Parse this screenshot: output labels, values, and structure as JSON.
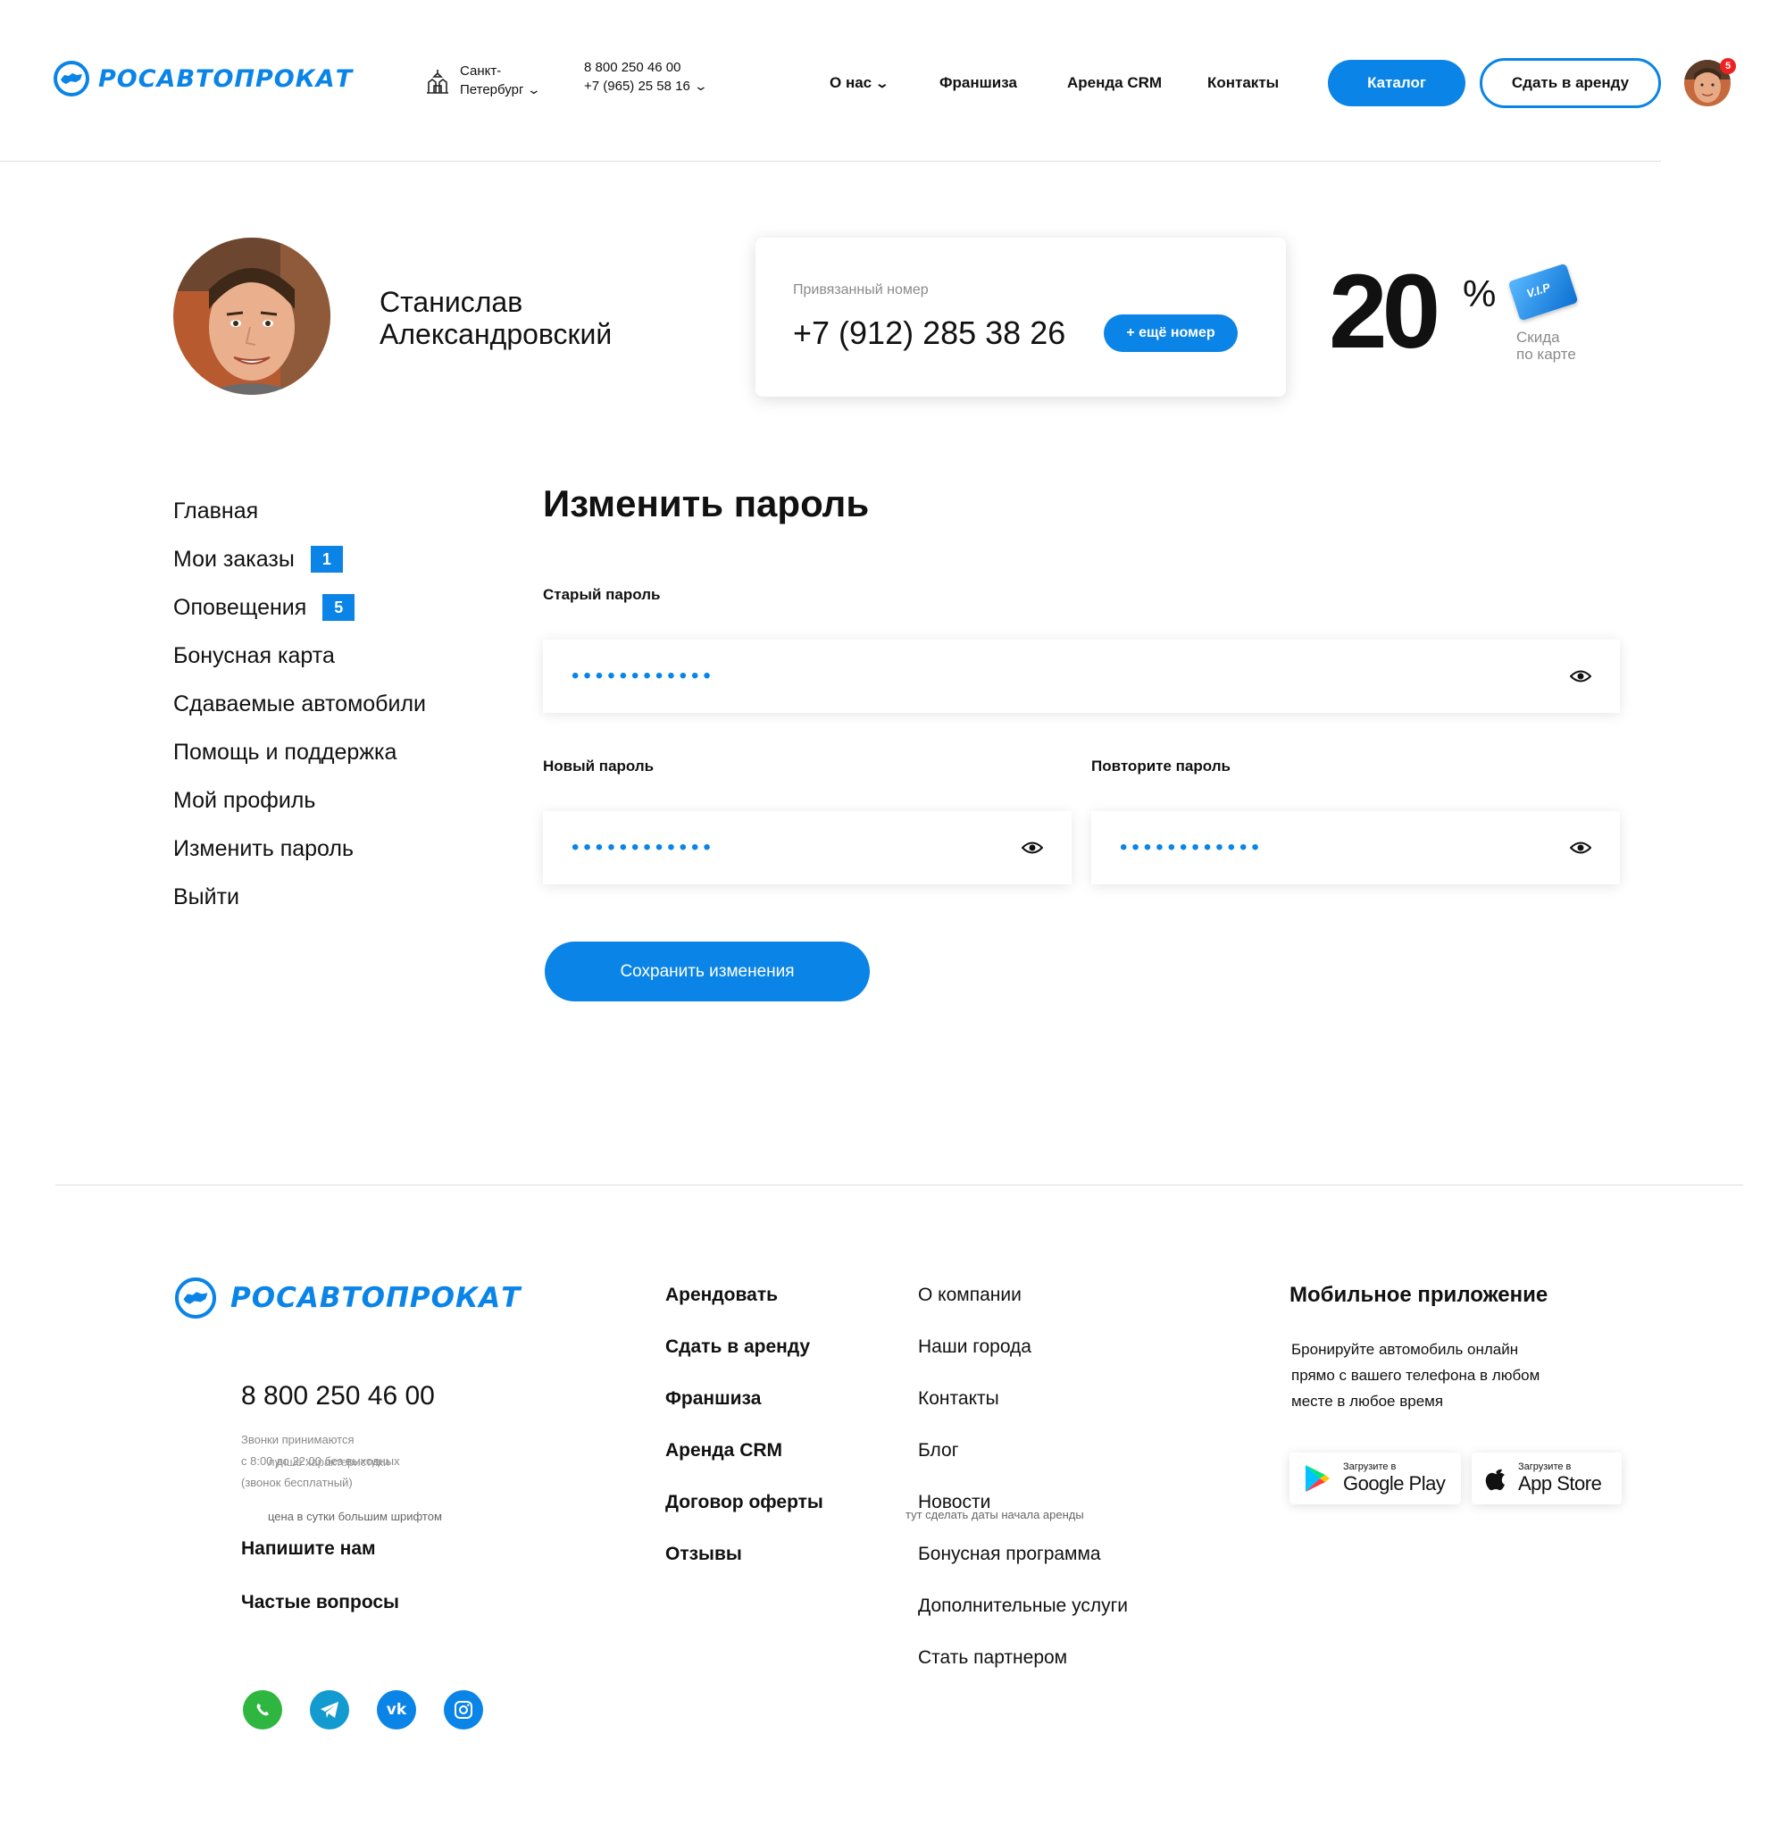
{
  "header": {
    "logo_text": "РОСАВТОПРОКАТ",
    "city_line1": "Санкт-",
    "city_line2": "Петербург",
    "phone1": "8 800 250 46 00",
    "phone2": "+7 (965) 25 58 16",
    "nav": {
      "about": "О нас",
      "franchise": "Франшиза",
      "crm": "Аренда CRM",
      "contacts": "Контакты"
    },
    "catalog_button": "Каталог",
    "rent_out_button": "Сдать в аренду",
    "notification_count": "5"
  },
  "profile": {
    "name_line1": "Станислав",
    "name_line2": "Александровский",
    "phone_card": {
      "label": "Привязанный номер",
      "phone": "+7 (912) 285 38 26",
      "add_button": "+ ещё номер"
    },
    "discount": {
      "value": "20",
      "unit": "%",
      "card_label": "V.I.P",
      "caption_line1": "Скида",
      "caption_line2": "по карте"
    }
  },
  "sidebar": {
    "items": [
      {
        "label": "Главная"
      },
      {
        "label": "Мои заказы",
        "badge": "1"
      },
      {
        "label": "Оповещения",
        "badge": "5"
      },
      {
        "label": "Бонусная карта"
      },
      {
        "label": "Сдаваемые автомобили"
      },
      {
        "label": "Помощь и поддержка"
      },
      {
        "label": "Мой профиль"
      },
      {
        "label": "Изменить пароль"
      },
      {
        "label": "Выйти"
      }
    ]
  },
  "form": {
    "title": "Изменить пароль",
    "old_password_label": "Старый пароль",
    "old_password_value": "••••••••••••",
    "new_password_label": "Новый пароль",
    "new_password_value": "••••••••••••",
    "repeat_password_label": "Повторите пароль",
    "repeat_password_value": "••••••••••••",
    "save_button": "Сохранить изменения"
  },
  "footer": {
    "logo_text": "РОСАВТОПРОКАТ",
    "phone": "8 800 250 46 00",
    "hours_line1": "Звонки принимаются",
    "hours_line2": "с 8:00 до 22:00 без выходных",
    "hours_line3": "(звонок бесплатный)",
    "note_overlay1": "лучше характеристики",
    "note_overlay2": "цена в сутки большим шрифтом",
    "note_overlay3": "тут сделать даты начала аренды",
    "write_us": "Напишите нам",
    "faq": "Частые вопросы",
    "col1": [
      "Арендовать",
      "Сдать в аренду",
      "Франшиза",
      "Аренда CRM",
      "Договор оферты",
      "Отзывы"
    ],
    "col2": [
      "О компании",
      "Наши города",
      "Контакты",
      "Блог",
      "Новости",
      "Бонусная программа",
      "Дополнительные услуги",
      "Стать партнером"
    ],
    "app_title": "Мобильное приложение",
    "app_text_line1": "Бронируйте автомобиль онлайн",
    "app_text_line2": "прямо с вашего телефона в любом",
    "app_text_line3": "месте в любое время",
    "google_small": "Загрузите в",
    "google_big": "Google Play",
    "apple_small": "Загрузите в",
    "apple_big": "App Store"
  },
  "colors": {
    "accent": "#0a84e6",
    "badge_red": "#e22222",
    "whatsapp": "#2fb640",
    "telegram": "#139bd0",
    "vk": "#0a84e6",
    "instagram": "#0a84e6"
  },
  "icons": [
    "city-icon",
    "chevron-down-icon",
    "eye-icon",
    "vip-card-icon",
    "google-play-icon",
    "apple-icon",
    "whatsapp-icon",
    "telegram-icon",
    "vk-icon",
    "instagram-icon"
  ]
}
